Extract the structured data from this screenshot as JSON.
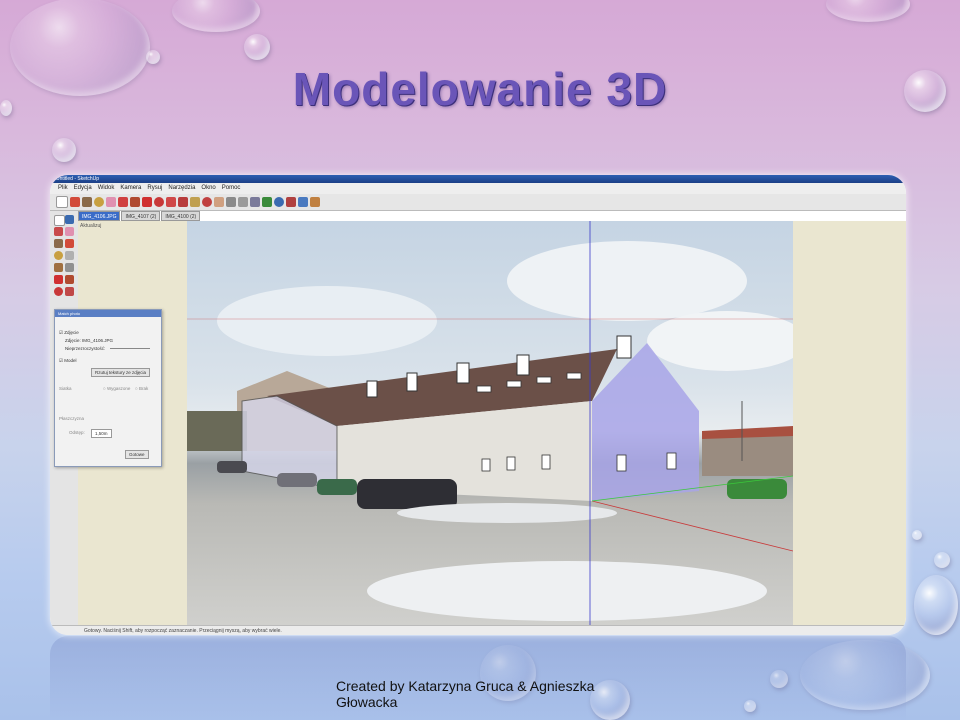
{
  "slide": {
    "title": "Modelowanie 3D",
    "credit_line1": "Created by Katarzyna Gruca & Agnieszka",
    "credit_line2": "Głowacka"
  },
  "app": {
    "window_title": "Untitled - SketchUp",
    "menu": [
      "Plik",
      "Edycja",
      "Widok",
      "Kamera",
      "Rysuj",
      "Narzędzia",
      "Okno",
      "Pomoc"
    ],
    "tabs": [
      {
        "label": "IMG_4106.JPG",
        "active": true
      },
      {
        "label": "IMG_4107 (2)",
        "active": false
      },
      {
        "label": "IMG_4100 (2)",
        "active": false
      }
    ],
    "viewport_hint": "Aktualizuj",
    "status": "Gotowy. Naciśnij Shift, aby rozpocząć zaznaczanie. Przeciągnij myszą, aby wybrać wiele."
  },
  "panel": {
    "title": "Match photo",
    "photo_label": "Zdjęcie",
    "file_label": "Zdjęcie:",
    "file_value": "IMG_4106.JPG",
    "opacity_label": "Nieprzezroczystość:",
    "model_label": "Model",
    "project_button": "Rzutuj tekstury ze zdjęcia",
    "style_label": "Siatka",
    "style_opt1": "Wygaszone",
    "style_opt2": "Brak",
    "plane_label": "Płaszczyzna",
    "spacing_label": "Odstęp:",
    "spacing_value": "1,50m",
    "done_button": "Gotowe"
  },
  "colors": {
    "title": "#6a55b8",
    "sky": "#c5d4e3",
    "roof": "#6b5048",
    "wall": "#e4e2dc",
    "model_overlay": "#a8a4e8",
    "axis_blue": "#3a3ac8",
    "axis_red": "#c83a3a",
    "axis_green": "#3ac83a"
  }
}
